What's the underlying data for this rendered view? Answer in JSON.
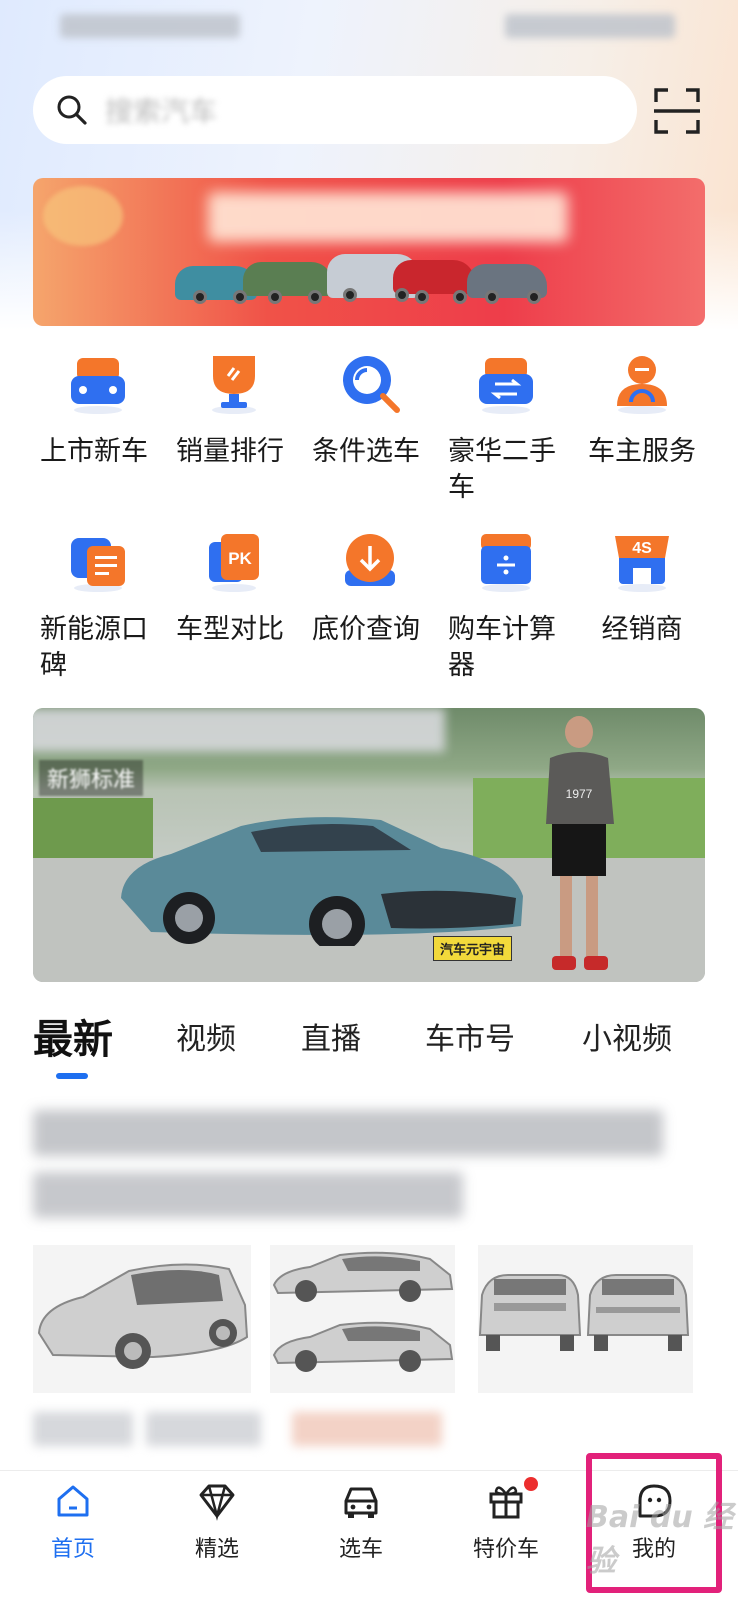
{
  "search": {
    "placeholder": "搜索汽车"
  },
  "quick_menu": {
    "row1": [
      {
        "label": "上市新车",
        "icon": "new-car-icon"
      },
      {
        "label": "销量排行",
        "icon": "trophy-icon"
      },
      {
        "label": "条件选车",
        "icon": "search-filter-icon"
      },
      {
        "label": "豪华二手车",
        "icon": "used-car-icon"
      },
      {
        "label": "车主服务",
        "icon": "owner-service-icon"
      }
    ],
    "row2": [
      {
        "label": "新能源口碑",
        "icon": "ev-review-icon"
      },
      {
        "label": "车型对比",
        "icon": "pk-compare-icon",
        "badge": "PK"
      },
      {
        "label": "底价查询",
        "icon": "price-query-icon"
      },
      {
        "label": "购车计算器",
        "icon": "calculator-icon"
      },
      {
        "label": "经销商",
        "icon": "dealer-4s-icon",
        "badge": "4S"
      }
    ]
  },
  "video_card": {
    "caption": "新狮标准",
    "plate": "汽车元宇宙",
    "shirt": "1977"
  },
  "content_tabs": [
    "最新",
    "视频",
    "直播",
    "车市号",
    "小视频"
  ],
  "bottom_nav": [
    {
      "label": "首页",
      "icon": "home-icon",
      "active": true
    },
    {
      "label": "精选",
      "icon": "diamond-icon",
      "active": false
    },
    {
      "label": "选车",
      "icon": "car-icon",
      "active": false
    },
    {
      "label": "特价车",
      "icon": "gift-icon",
      "active": false,
      "badge_dot": true
    },
    {
      "label": "我的",
      "icon": "profile-icon",
      "active": false
    }
  ],
  "watermark": "Bai du 经验",
  "colors": {
    "accent": "#1e6ff0",
    "orange": "#f4762a",
    "highlight": "#e2217a",
    "badge_red": "#ec2e2e"
  }
}
